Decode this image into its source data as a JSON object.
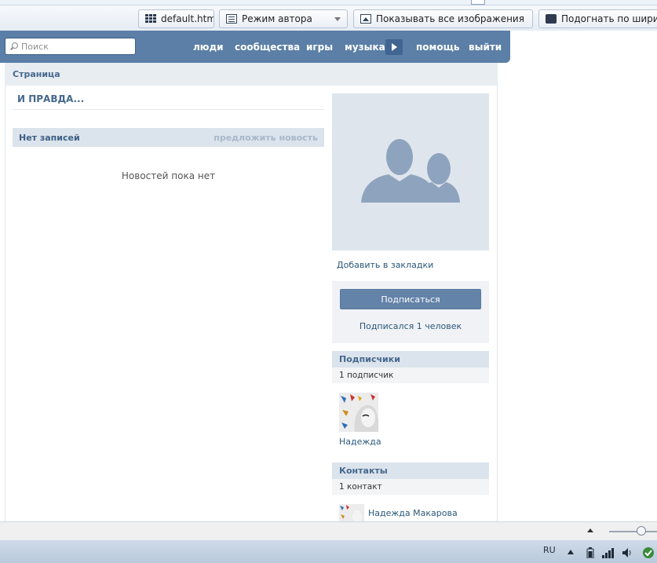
{
  "browser": {
    "toolbar": {
      "tab_file": "default.htm",
      "author_mode": "Режим автора",
      "show_images": "Показывать все изображения",
      "fit_width": "Подогнать по ширине"
    }
  },
  "vk": {
    "search": {
      "placeholder": "Поиск"
    },
    "nav": [
      "люди",
      "сообщества",
      "игры",
      "музыка",
      "помощь",
      "выйти"
    ],
    "page_bar": "Страница",
    "page_title": "И ПРАВДА...",
    "wall": {
      "header": "Нет записей",
      "suggest": "предложить новость",
      "empty": "Новостей пока нет"
    },
    "sidebar": {
      "bookmark": "Добавить в закладки",
      "subscribe_button": "Подписаться",
      "subscribed_count": "Подписался 1 человек",
      "followers_title": "Подписчики",
      "followers_count": "1 подписчик",
      "follower_name": "Надежда",
      "contacts_title": "Контакты",
      "contacts_count": "1 контакт",
      "contact_name": "Надежда Макарова"
    },
    "colors": {
      "header_blue": "#5b7fa6",
      "link_blue": "#2b587a",
      "button_blue": "#6383a8"
    }
  },
  "system": {
    "language": "RU"
  }
}
